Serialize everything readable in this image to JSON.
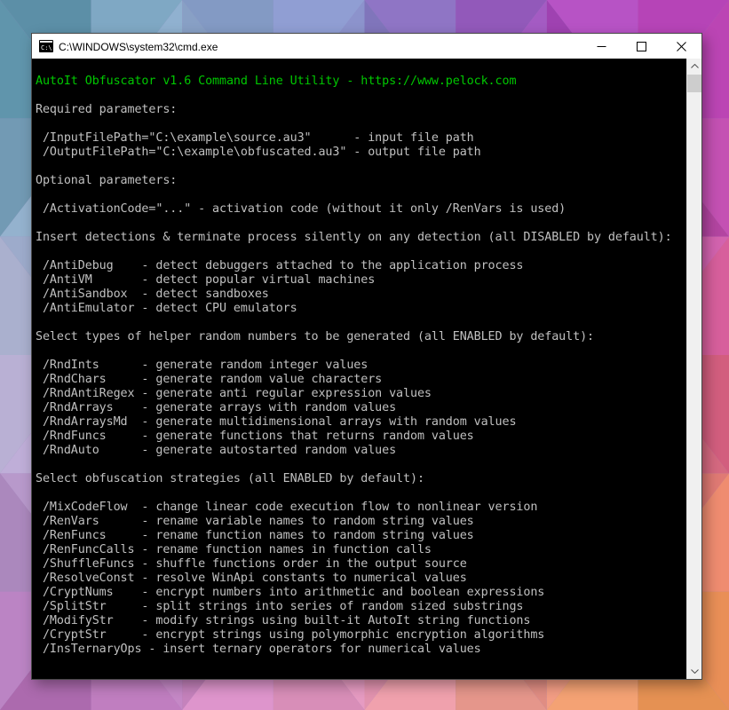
{
  "window": {
    "title": "C:\\WINDOWS\\system32\\cmd.exe",
    "titlebar_bg": "#ffffff",
    "border_color": "#484848"
  },
  "terminal": {
    "colors": {
      "background": "#000000",
      "text": "#c0c0c0",
      "header_text": "#00c800"
    },
    "header_line": "AutoIt Obfuscator v1.6 Command Line Utility - https://www.pelock.com",
    "body_lines": [
      "",
      "Required parameters:",
      "",
      " /InputFilePath=\"C:\\example\\source.au3\"      - input file path",
      " /OutputFilePath=\"C:\\example\\obfuscated.au3\" - output file path",
      "",
      "Optional parameters:",
      "",
      " /ActivationCode=\"...\" - activation code (without it only /RenVars is used)",
      "",
      "Insert detections & terminate process silently on any detection (all DISABLED by default):",
      "",
      " /AntiDebug    - detect debuggers attached to the application process",
      " /AntiVM       - detect popular virtual machines",
      " /AntiSandbox  - detect sandboxes",
      " /AntiEmulator - detect CPU emulators",
      "",
      "Select types of helper random numbers to be generated (all ENABLED by default):",
      "",
      " /RndInts      - generate random integer values",
      " /RndChars     - generate random value characters",
      " /RndAntiRegex - generate anti regular expression values",
      " /RndArrays    - generate arrays with random values",
      " /RndArraysMd  - generate multidimensional arrays with random values",
      " /RndFuncs     - generate functions that returns random values",
      " /RndAuto      - generate autostarted random values",
      "",
      "Select obfuscation strategies (all ENABLED by default):",
      "",
      " /MixCodeFlow  - change linear code execution flow to nonlinear version",
      " /RenVars      - rename variable names to random string values",
      " /RenFuncs     - rename function names to random string values",
      " /RenFuncCalls - rename function names in function calls",
      " /ShuffleFuncs - shuffle functions order in the output source",
      " /ResolveConst - resolve WinApi constants to numerical values",
      " /CryptNums    - encrypt numbers into arithmetic and boolean expressions",
      " /SplitStr     - split strings into series of random sized substrings",
      " /ModifyStr    - modify strings using built-it AutoIt string functions",
      " /CryptStr     - encrypt strings using polymorphic encryption algorithms",
      " /InsTernaryOps - insert ternary operators for numerical values"
    ]
  },
  "scrollbar": {
    "track_color": "#f0f0f0",
    "thumb_color": "#cdcdcd",
    "arrow_color": "#505050"
  },
  "wallpaper": {
    "style": "low-poly faceted gradient",
    "grid": [
      [
        "#4F90A4",
        "#86A9C8",
        "#7C83C4",
        "#A34CC0",
        "#BE3DB4"
      ],
      [
        "#6E9DB5",
        "#9FB4D6",
        "#8F8EC8",
        "#AC54BE",
        "#C04BAE"
      ],
      [
        "#C0BAD8",
        "#B9B2DC",
        "#B795CC",
        "#C468B2",
        "#E0608C"
      ],
      [
        "#9C86B8",
        "#C490C8",
        "#D88BB8",
        "#E88895",
        "#EC8668"
      ],
      [
        "#B368B4",
        "#CC82C4",
        "#E698B4",
        "#EFA378",
        "#EC9A40"
      ]
    ]
  }
}
